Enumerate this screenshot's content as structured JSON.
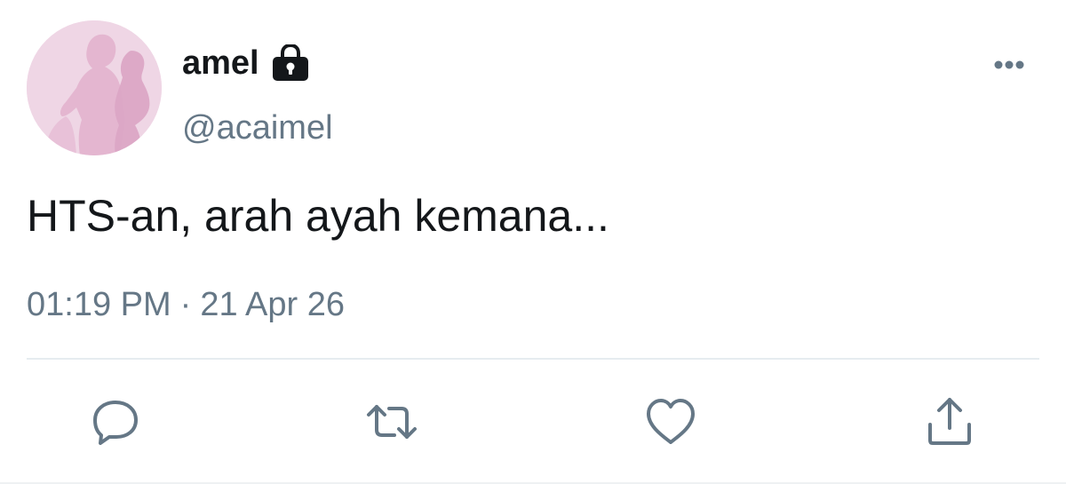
{
  "tweet": {
    "display_name": "amel",
    "handle": "@acaimel",
    "text": "HTS-an, arah ayah kemana...",
    "time": "01:19 PM",
    "separator": "·",
    "date": "21 Apr 26",
    "protected": true
  },
  "icons": {
    "lock": "lock-icon",
    "more": "more-horizontal-icon",
    "reply": "reply-icon",
    "retweet": "retweet-icon",
    "like": "heart-icon",
    "share": "share-icon"
  },
  "colors": {
    "text_primary": "#14171a",
    "text_secondary": "#657786",
    "divider": "#e6ecf0",
    "avatar_bg": "#efd6e5"
  }
}
